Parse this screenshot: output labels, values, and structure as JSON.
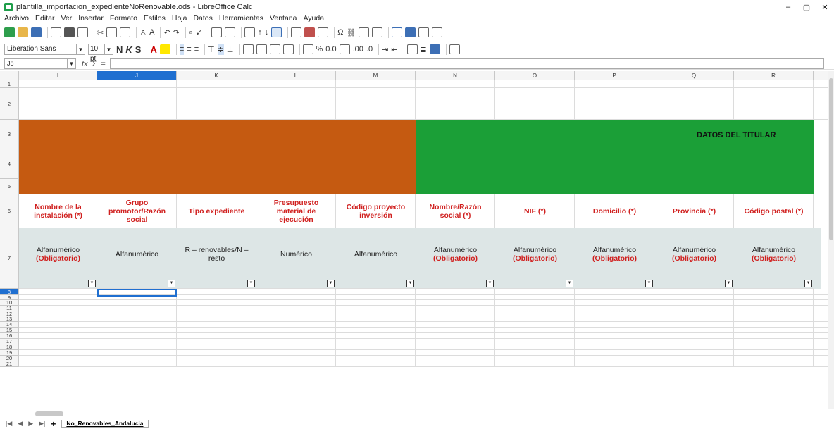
{
  "window": {
    "title": "plantilla_importacion_expedienteNoRenovable.ods - LibreOffice Calc",
    "controls": [
      "–",
      "▢",
      "✕"
    ]
  },
  "menu": [
    "Archivo",
    "Editar",
    "Ver",
    "Insertar",
    "Formato",
    "Estilos",
    "Hoja",
    "Datos",
    "Herramientas",
    "Ventana",
    "Ayuda"
  ],
  "format": {
    "font_name": "Liberation Sans",
    "font_size": "10 pt",
    "bold": "N",
    "italic": "K",
    "underline": "S"
  },
  "formula_bar": {
    "cell_ref": "J8",
    "fx": "fx",
    "sigma": "Σ",
    "equals": "="
  },
  "columns": [
    "I",
    "J",
    "K",
    "L",
    "M",
    "N",
    "O",
    "P",
    "Q",
    "R"
  ],
  "rows": [
    "1",
    "2",
    "3",
    "4",
    "5",
    "6",
    "7",
    "8",
    "9",
    "10",
    "11",
    "12",
    "13",
    "14",
    "15",
    "16",
    "17",
    "18",
    "19",
    "20",
    "21"
  ],
  "band": {
    "titular_label": "DATOS DEL TITULAR",
    "orange_color": "#c55a11",
    "green_color": "#1b9f37"
  },
  "headers": [
    "Nombre de la instalación (*)",
    "Grupo promotor/Razón social",
    "Tipo expediente",
    "Presupuesto material de ejecución",
    "Código proyecto inversión",
    "Nombre/Razón social (*)",
    "NIF (*)",
    "Domicilio (*)",
    "Provincia (*)",
    "Código postal (*)"
  ],
  "types": [
    {
      "text": "Alfanumérico",
      "note": "(Obligatorio)"
    },
    {
      "text": "Alfanumérico",
      "note": ""
    },
    {
      "text": "R – renovables/N – resto",
      "note": ""
    },
    {
      "text": "Numérico",
      "note": ""
    },
    {
      "text": "Alfanumérico",
      "note": ""
    },
    {
      "text": "Alfanumérico",
      "note": "(Obligatorio)"
    },
    {
      "text": "Alfanumérico",
      "note": "(Obligatorio)"
    },
    {
      "text": "Alfanumérico",
      "note": "(Obligatorio)"
    },
    {
      "text": "Alfanumérico",
      "note": "(Obligatorio)"
    },
    {
      "text": "Alfanumérico",
      "note": "(Obligatorio)"
    }
  ],
  "sheet_tab": "No_Renovables_Andalucia"
}
